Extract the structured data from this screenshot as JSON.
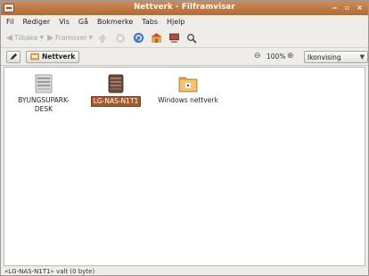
{
  "window": {
    "title": "Nettverk - Filframvisar"
  },
  "menubar": {
    "items": [
      "Fil",
      "Rediger",
      "Vis",
      "Gå",
      "Bokmerke",
      "Tabs",
      "Hjelp"
    ]
  },
  "toolbar": {
    "back_label": "Tilbake",
    "forward_label": "Framover",
    "icons": [
      "up-icon",
      "stop-icon",
      "reload-icon",
      "home-icon",
      "computer-icon",
      "search-icon"
    ]
  },
  "location": {
    "breadcrumb": "Nettverk",
    "zoom_level": "100%",
    "view_mode": "Ikonvising"
  },
  "files": [
    {
      "label_line1": "BYUNGSUPARK-",
      "label_line2": "DESK",
      "icon": "computer-icon"
    },
    {
      "label_line1": "LG-NAS-N1T1",
      "label_line2": "",
      "icon": "nas-server-icon",
      "selected": true
    },
    {
      "label_line1": "Windows nettverk",
      "label_line2": "",
      "icon": "network-folder-icon"
    }
  ],
  "status": {
    "text": "«LG-NAS-N1T1» valt (0 byte)"
  },
  "colors": {
    "titlebar": "#c17a45",
    "selection": "#a55a2c"
  }
}
